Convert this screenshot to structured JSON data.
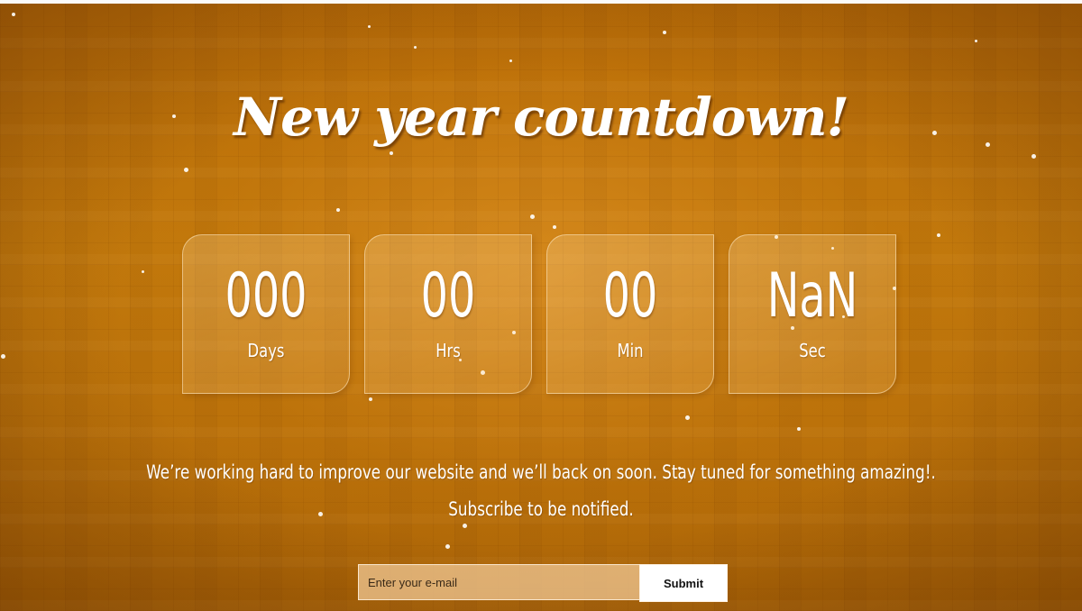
{
  "page": {
    "title": "New year countdown!",
    "background_color": "#c0780c"
  },
  "countdown": [
    {
      "value": "000",
      "label": "Days"
    },
    {
      "value": "00",
      "label": "Hrs"
    },
    {
      "value": "00",
      "label": "Min"
    },
    {
      "value": "NaN",
      "label": "Sec"
    }
  ],
  "message": {
    "line1": "We’re working hard to improve our website and we’ll back on soon. Stay tuned for something amazing!.",
    "line2": "Subscribe to be notified."
  },
  "subscribe": {
    "placeholder": "Enter your e-mail",
    "submit_label": "Submit"
  }
}
